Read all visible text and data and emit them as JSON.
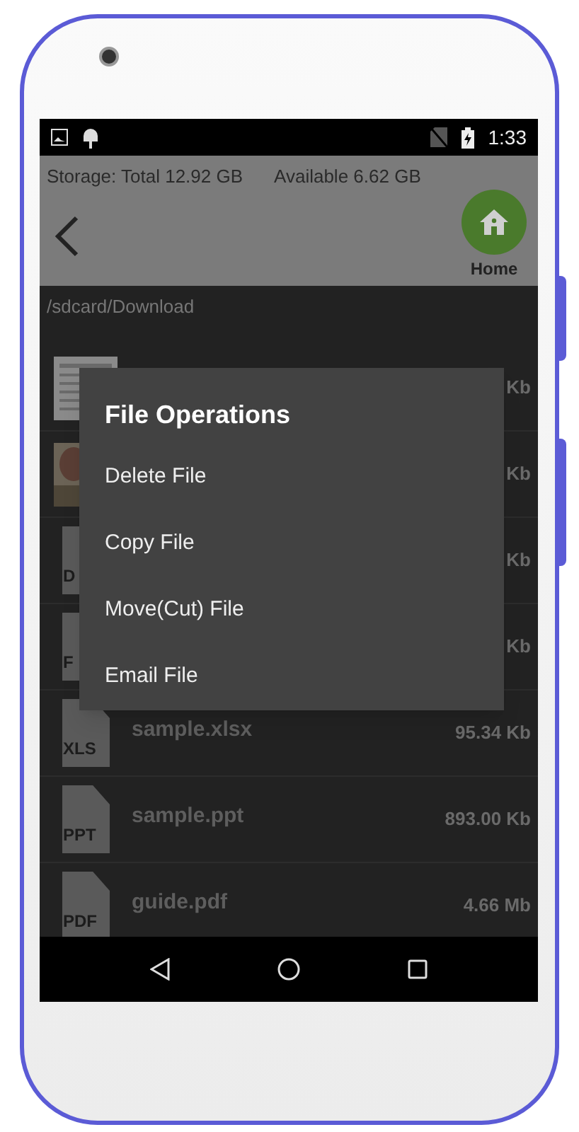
{
  "status_bar": {
    "time": "1:33"
  },
  "storage": {
    "total": "Storage: Total 12.92 GB",
    "available": "Available 6.62 GB"
  },
  "home_button": {
    "label": "Home"
  },
  "path": "/sdcard/Download",
  "files": [
    {
      "kind": "scan",
      "size": "Kb"
    },
    {
      "size": "Kb"
    },
    {
      "kind": "doc",
      "badge": "D",
      "size": "Kb"
    },
    {
      "kind": "doc",
      "badge": "F",
      "size": "Kb"
    },
    {
      "kind": "doc",
      "badge": "XLS",
      "name": "sample.xlsx",
      "size": "95.34 Kb"
    },
    {
      "kind": "doc",
      "badge": "PPT",
      "name": "sample.ppt",
      "size": "893.00 Kb"
    },
    {
      "kind": "doc",
      "badge": "PDF",
      "name": "guide.pdf",
      "size": "4.66 Mb"
    }
  ],
  "dialog": {
    "title": "File Operations",
    "items": [
      "Delete File",
      "Copy File",
      "Move(Cut) File",
      "Email File"
    ]
  }
}
